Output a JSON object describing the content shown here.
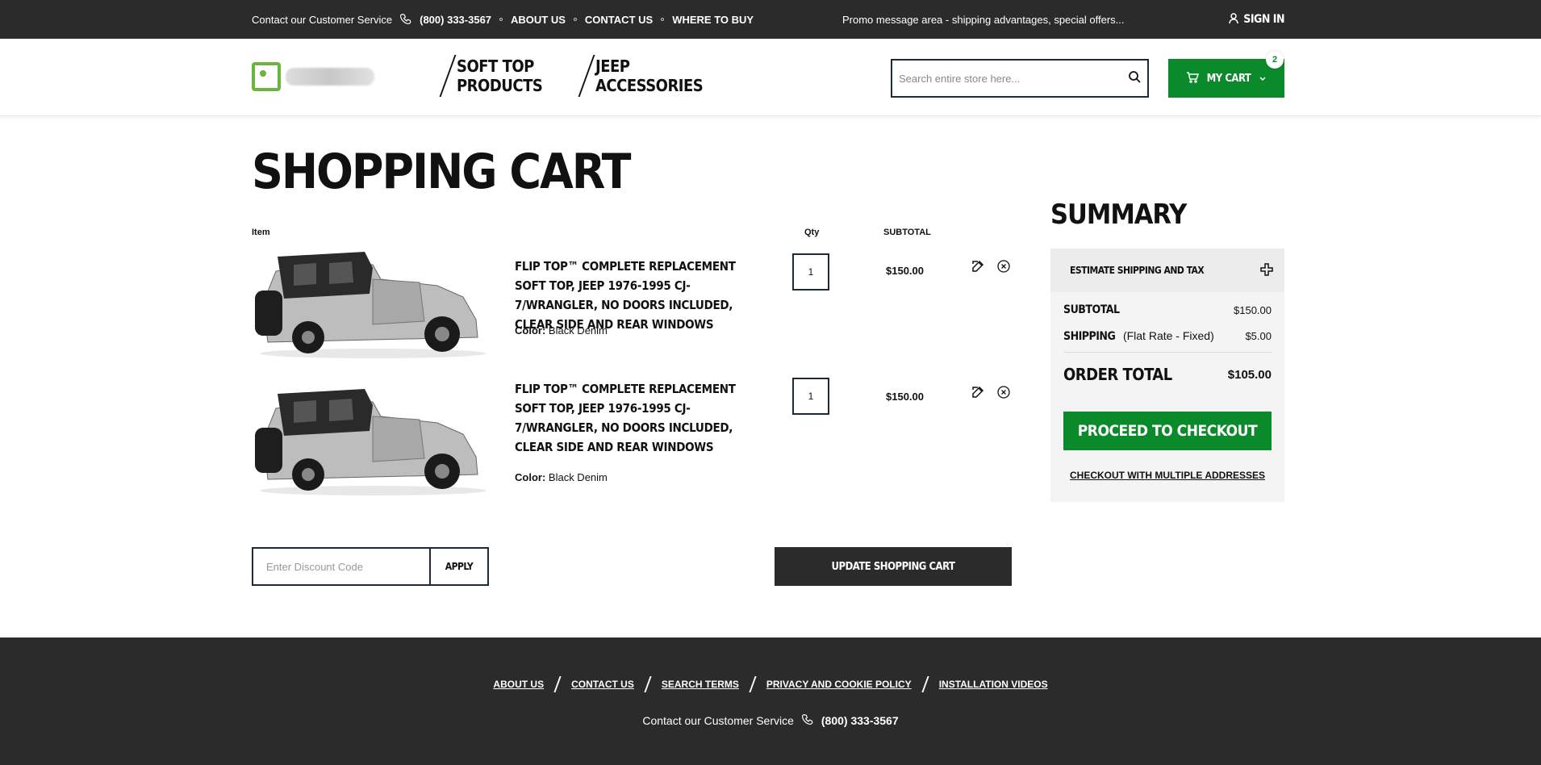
{
  "topbar": {
    "contact_text": "Contact our Customer Service",
    "phone": "(800) 333-3567",
    "links": [
      "ABOUT US",
      "CONTACT US",
      "WHERE TO BUY"
    ],
    "promo": "Promo message area - shipping advantages, special offers...",
    "signin": "SIGN IN"
  },
  "header": {
    "nav": [
      "SOFT TOP PRODUCTS",
      "JEEP ACCESSORIES"
    ],
    "search_placeholder": "Search entire store here...",
    "cart_label": "MY CART",
    "cart_count": "2"
  },
  "cart": {
    "title": "SHOPPING CART",
    "col_item": "Item",
    "col_qty": "Qty",
    "col_subtotal": "SUBTOTAL",
    "items": [
      {
        "name": "FLIP TOP™ COMPLETE REPLACEMENT SOFT TOP, JEEP 1976-1995 CJ-7/WRANGLER, NO DOORS INCLUDED, CLEAR SIDE AND REAR WINDOWS",
        "color_label": "Color:",
        "color_value": "Black Denim",
        "qty": "1",
        "price": "$150.00"
      },
      {
        "name": "FLIP TOP™ COMPLETE REPLACEMENT SOFT TOP, JEEP 1976-1995 CJ-7/WRANGLER, NO DOORS INCLUDED, CLEAR SIDE AND REAR WINDOWS",
        "color_label": "Color:",
        "color_value": "Black Denim",
        "qty": "1",
        "price": "$150.00"
      }
    ],
    "discount_placeholder": "Enter Discount Code",
    "apply_label": "APPLY",
    "update_label": "UPDATE SHOPPING CART"
  },
  "summary": {
    "title": "SUMMARY",
    "estimate_label": "ESTIMATE SHIPPING AND TAX",
    "subtotal_label": "SUBTOTAL",
    "subtotal_value": "$150.00",
    "shipping_label": "SHIPPING",
    "shipping_note": "(Flat Rate - Fixed)",
    "shipping_value": "$5.00",
    "order_total_label": "ORDER TOTAL",
    "order_total_value": "$105.00",
    "checkout_label": "PROCEED TO CHECKOUT",
    "multi_label": "CHECKOUT WITH MULTIPLE ADDRESSES"
  },
  "footer": {
    "links": [
      "ABOUT US",
      "CONTACT US",
      "SEARCH TERMS",
      "PRIVACY AND COOKIE POLICY",
      "INSTALLATION VIDEOS"
    ],
    "contact_text": "Contact our Customer Service",
    "phone": "(800) 333-3567"
  },
  "colors": {
    "dark": "#2b2b2b",
    "brand_green": "#0a8a2a",
    "logo_green": "#6db33f",
    "border_navy": "#1d2838"
  }
}
